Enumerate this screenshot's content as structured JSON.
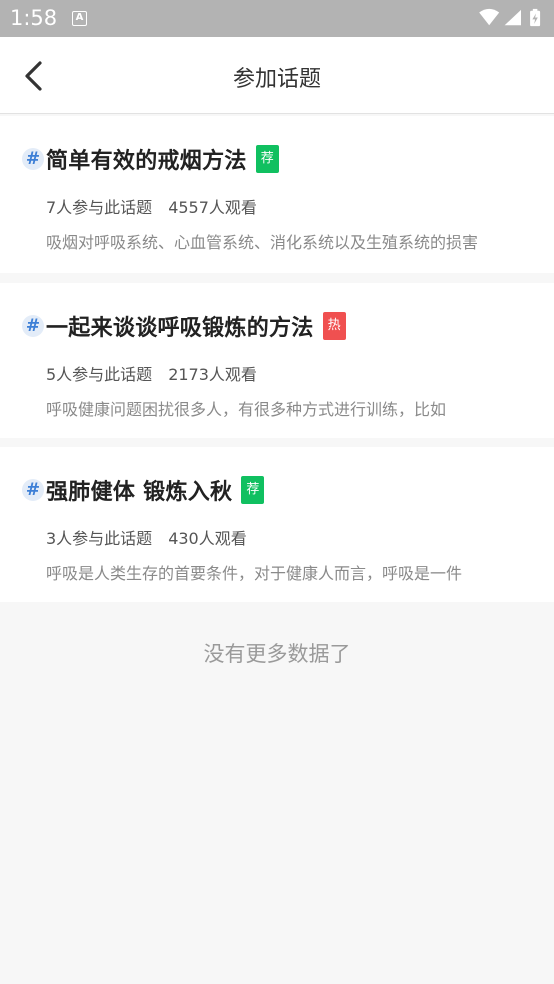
{
  "status_bar": {
    "time": "1:58",
    "notification_icon": "A",
    "icons": [
      "wifi-icon",
      "signal-icon",
      "battery-charging-icon"
    ]
  },
  "header": {
    "title": "参加话题",
    "back_icon": "chevron-left-icon"
  },
  "topics": [
    {
      "hash": "#",
      "title": "简单有效的戒烟方法",
      "badge": "荐",
      "badge_type": "recommend",
      "participants": "7人参与此话题",
      "views": "4557人观看",
      "description": "吸烟对呼吸系统、心血管系统、消化系统以及生殖系统的损害"
    },
    {
      "hash": "#",
      "title": "一起来谈谈呼吸锻炼的方法",
      "badge": "热",
      "badge_type": "hot",
      "participants": "5人参与此话题",
      "views": "2173人观看",
      "description": "呼吸健康问题困扰很多人，有很多种方式进行训练，比如"
    },
    {
      "hash": "#",
      "title": "强肺健体 锻炼入秋",
      "badge": "荐",
      "badge_type": "recommend",
      "participants": "3人参与此话题",
      "views": "430人观看",
      "description": "呼吸是人类生存的首要条件，对于健康人而言，呼吸是一件"
    }
  ],
  "footer_text": "没有更多数据了",
  "colors": {
    "recommend_badge": "#10c060",
    "hot_badge": "#f05050",
    "hash_accent": "#3d7fd6",
    "status_bar": "#b3b3b3"
  }
}
